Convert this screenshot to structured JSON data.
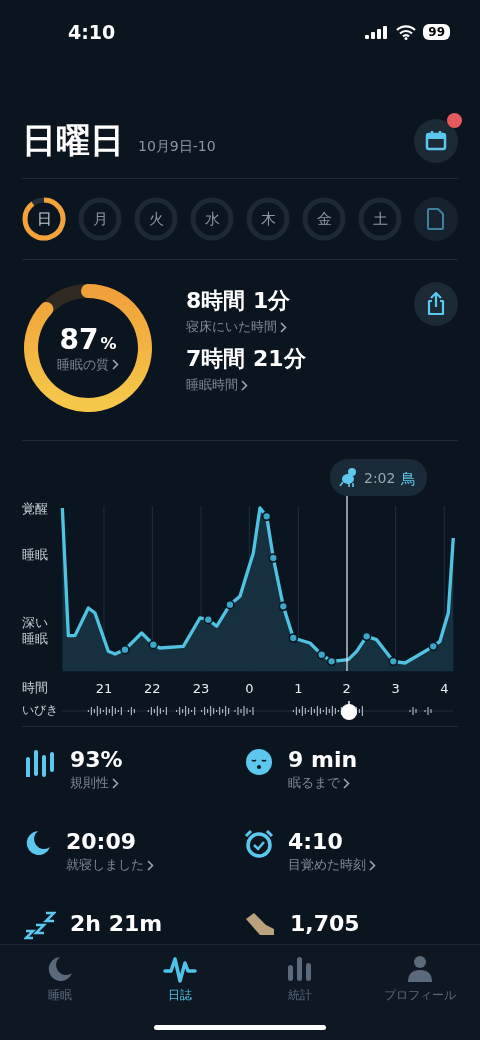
{
  "status_bar": {
    "time": "4:10",
    "battery": "99"
  },
  "header": {
    "title": "日曜日",
    "date_range": "10月9日-10",
    "notification": true
  },
  "days": [
    {
      "label": "日",
      "selected": true
    },
    {
      "label": "月",
      "selected": false
    },
    {
      "label": "火",
      "selected": false
    },
    {
      "label": "水",
      "selected": false
    },
    {
      "label": "木",
      "selected": false
    },
    {
      "label": "金",
      "selected": false
    },
    {
      "label": "土",
      "selected": false
    }
  ],
  "summary": {
    "quality": {
      "value": "87",
      "unit": "%",
      "label": "睡眠の質"
    },
    "metrics": [
      {
        "value": "8時間 1分",
        "label": "寝床にいた時間"
      },
      {
        "value": "7時間 21分",
        "label": "睡眠時間"
      }
    ]
  },
  "chart": {
    "marker": {
      "time": "2:02",
      "label": "鳥"
    },
    "y_labels": [
      "覚醒",
      "睡眠",
      "深い睡眠"
    ],
    "x_title": "時間",
    "x_labels": [
      "21",
      "22",
      "23",
      "0",
      "1",
      "2",
      "3",
      "4"
    ],
    "snore_title": "いびき"
  },
  "stats": [
    {
      "kind": "regularity",
      "value": "93%",
      "label": "規則性"
    },
    {
      "kind": "fall_asleep",
      "value": "9 min",
      "label": "眠るまで"
    },
    {
      "kind": "bedtime",
      "value": "20:09",
      "label": "就寝しました"
    },
    {
      "kind": "wake",
      "value": "4:10",
      "label": "目覚めた時刻"
    },
    {
      "kind": "snore",
      "value": "2h 21m"
    },
    {
      "kind": "steps",
      "value": "1,705"
    }
  ],
  "tabs": [
    {
      "kind": "moon",
      "label": "睡眠",
      "selected": false
    },
    {
      "kind": "wave",
      "label": "日誌",
      "selected": true
    },
    {
      "kind": "bars",
      "label": "統計",
      "selected": false
    },
    {
      "kind": "person",
      "label": "プロフィール",
      "selected": false
    }
  ]
}
